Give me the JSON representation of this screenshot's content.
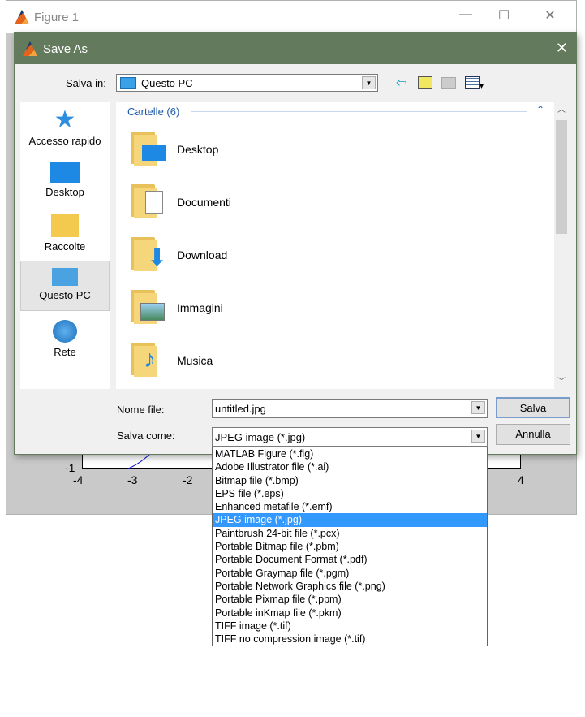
{
  "figure": {
    "title": "Figure 1",
    "ticks_x": [
      "-4",
      "-3",
      "-2",
      "4"
    ],
    "tick_y": "-1"
  },
  "dialog": {
    "title": "Save As",
    "save_in_label": "Salva in:",
    "save_in_value": "Questo PC",
    "nav": [
      {
        "label": "Accesso rapido",
        "icon": "star-icon"
      },
      {
        "label": "Desktop",
        "icon": "desktop-icon"
      },
      {
        "label": "Raccolte",
        "icon": "libraries-icon"
      },
      {
        "label": "Questo PC",
        "icon": "computer-icon",
        "selected": true
      },
      {
        "label": "Rete",
        "icon": "network-icon"
      }
    ],
    "group_header": "Cartelle (6)",
    "folders": [
      {
        "name": "Desktop"
      },
      {
        "name": "Documenti"
      },
      {
        "name": "Download"
      },
      {
        "name": "Immagini"
      },
      {
        "name": "Musica"
      }
    ],
    "filename_label": "Nome file:",
    "filename_value": "untitled.jpg",
    "type_label": "Salva come:",
    "type_value": "JPEG image (*.jpg)",
    "save_button": "Salva",
    "cancel_button": "Annulla",
    "type_options": [
      "MATLAB Figure (*.fig)",
      "Adobe Illustrator file (*.ai)",
      "Bitmap file (*.bmp)",
      "EPS file (*.eps)",
      "Enhanced metafile (*.emf)",
      "JPEG image (*.jpg)",
      "Paintbrush 24-bit file (*.pcx)",
      "Portable Bitmap file (*.pbm)",
      "Portable Document Format (*.pdf)",
      "Portable Graymap file (*.pgm)",
      "Portable Network Graphics file (*.png)",
      "Portable Pixmap file (*.ppm)",
      "Portable inKmap file (*.pkm)",
      "TIFF image (*.tif)",
      "TIFF no compression image (*.tif)"
    ],
    "selected_option": 5,
    "colors": {
      "titlebar": "#637a5c",
      "selection": "#3399ff"
    }
  }
}
